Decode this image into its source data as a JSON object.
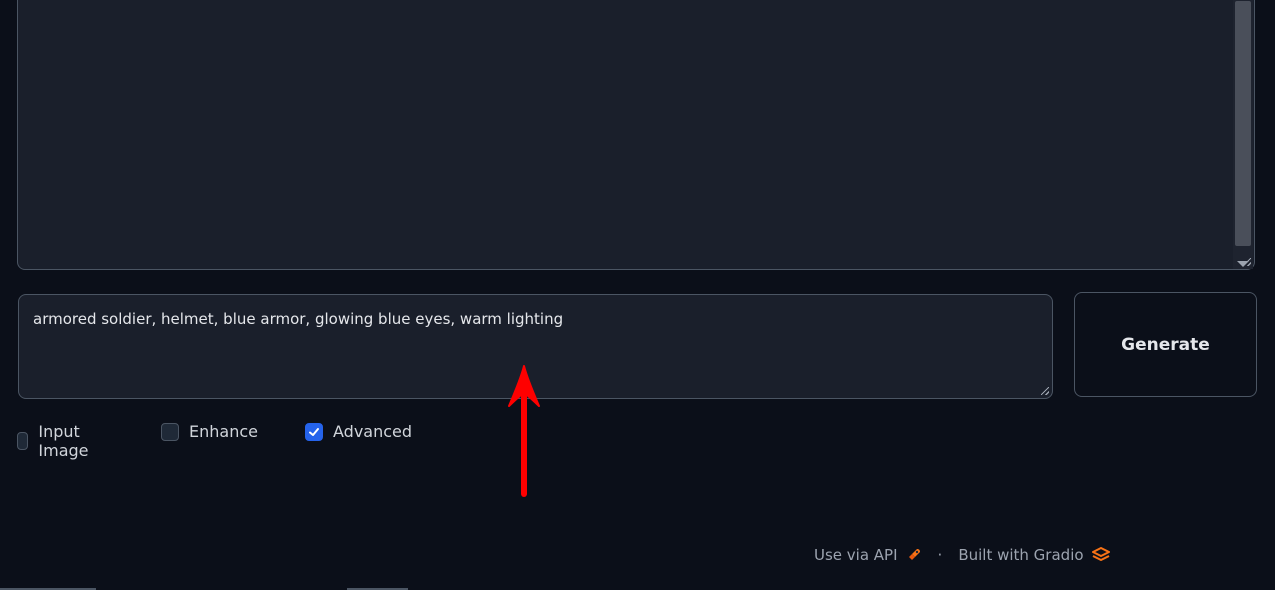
{
  "prompt": {
    "value": "armored soldier, helmet, blue armor, glowing blue eyes, warm lighting"
  },
  "generate_button": {
    "label": "Generate"
  },
  "options": [
    {
      "label": "Input Image",
      "checked": false
    },
    {
      "label": "Enhance",
      "checked": false
    },
    {
      "label": "Advanced",
      "checked": true
    }
  ],
  "footer": {
    "api_label": "Use via API",
    "separator": "·",
    "built_label": "Built with Gradio"
  },
  "colors": {
    "background": "#0b0f19",
    "panel": "#1a1f2b",
    "accent_checkbox": "#2563eb",
    "gradio_orange": "#f97316",
    "annotation_arrow": "#ff0000"
  },
  "icons": {
    "api": "rocket-icon",
    "gradio": "gradio-logo-icon"
  }
}
